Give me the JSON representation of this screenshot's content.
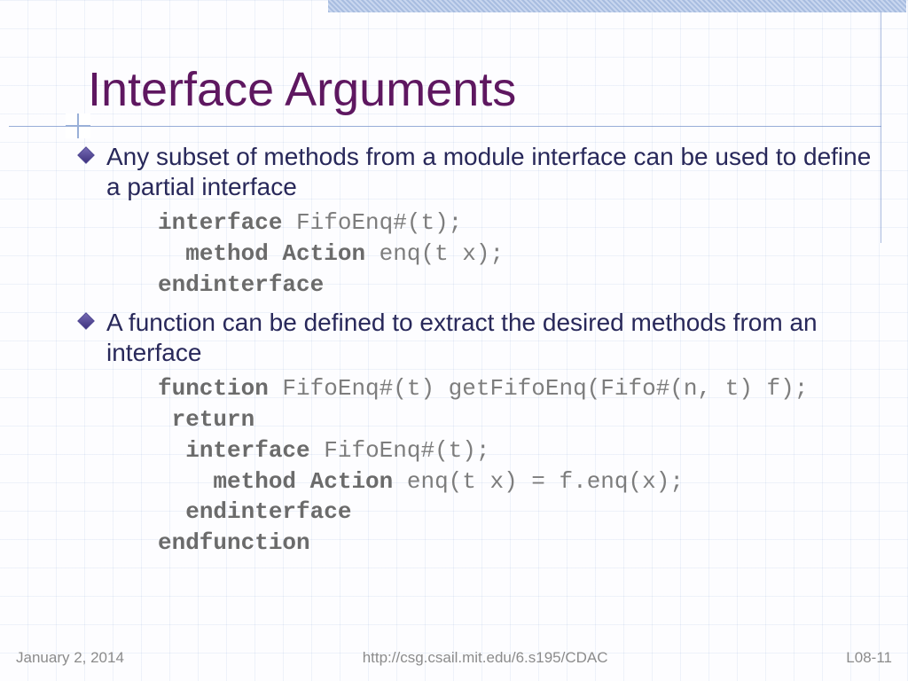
{
  "title": "Interface Arguments",
  "bullets": {
    "b1": "Any subset of methods from a module interface can be used to define a partial interface",
    "b2": "A function can be defined to extract the desired methods from an interface"
  },
  "code1": {
    "l1a": "interface",
    "l1b": " FifoEnq#(t);",
    "l2a": "method Action",
    "l2b": " enq(t x);",
    "l3a": "endinterface"
  },
  "code2": {
    "l1a": "function",
    "l1b": " FifoEnq#(t) getFifoEnq(Fifo#(n, t) f);",
    "l2a": "return",
    "l3a": "interface",
    "l3b": " FifoEnq#(t);",
    "l4a": "method Action",
    "l4b": " enq(t x) = f.enq(x);",
    "l5a": "endinterface",
    "l6a": "endfunction"
  },
  "footer": {
    "date": "January 2, 2014",
    "url": "http://csg.csail.mit.edu/6.s195/CDAC",
    "page": "L08-11"
  }
}
